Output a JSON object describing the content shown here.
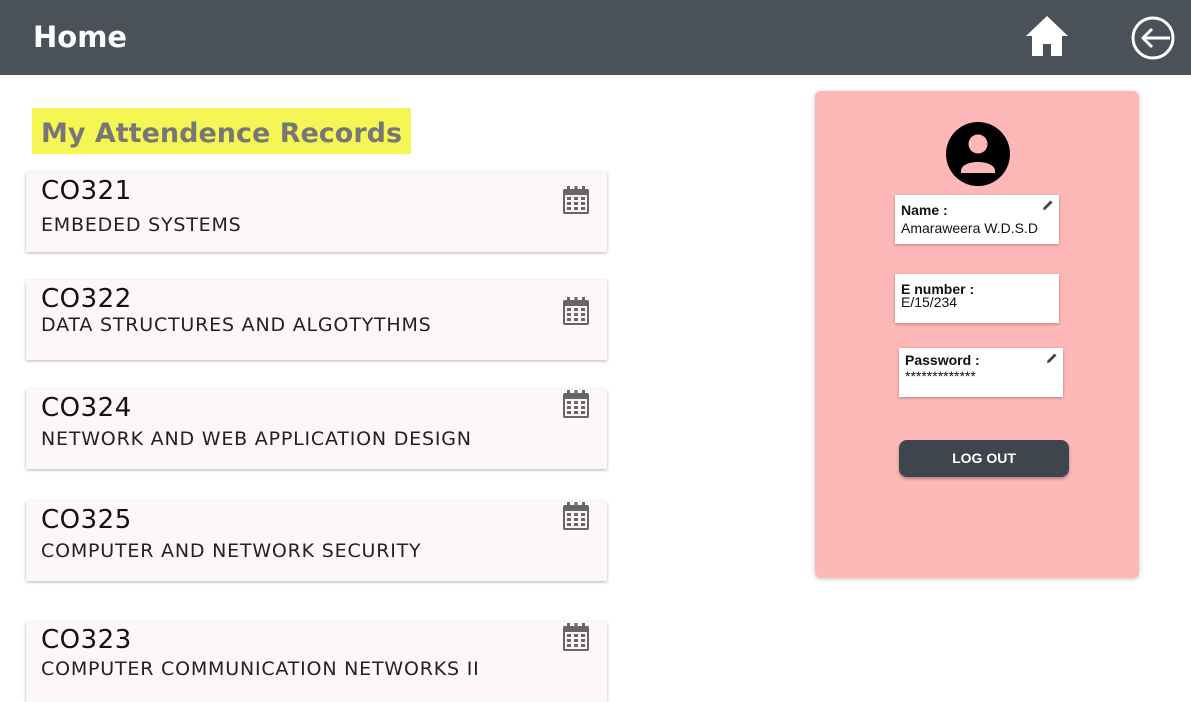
{
  "header": {
    "title": "Home",
    "home_icon": "home-icon",
    "logout_icon": "logout-arrow-icon"
  },
  "main": {
    "section_title": "My Attendence Records",
    "courses": [
      {
        "code": "CO321",
        "name": " EMBEDED SYSTEMS",
        "icon": "calendar-icon"
      },
      {
        "code": "CO322",
        "name": "DATA STRUCTURES AND ALGOTYTHMS",
        "icon": "calendar-icon"
      },
      {
        "code": "CO324",
        "name": "NETWORK AND WEB APPLICATION DESIGN",
        "icon": "calendar-icon"
      },
      {
        "code": "CO325",
        "name": "COMPUTER AND NETWORK SECURITY",
        "icon": "calendar-icon"
      },
      {
        "code": "CO323",
        "name": "COMPUTER COMMUNICATION NETWORKS  II",
        "icon": "calendar-icon"
      }
    ]
  },
  "profile": {
    "avatar_icon": "user-avatar-icon",
    "name_label": "Name :",
    "name_value": "Amaraweera W.D.S.D",
    "enumber_label": "E number :",
    "enumber_value": "E/15/234",
    "password_label": "Password :",
    "password_value": "*************",
    "logout_label": "LOG OUT"
  },
  "colors": {
    "topbar": "#4b5158",
    "highlight": "#f5f553",
    "panel": "#ffb8b8",
    "button": "#3f454c"
  }
}
